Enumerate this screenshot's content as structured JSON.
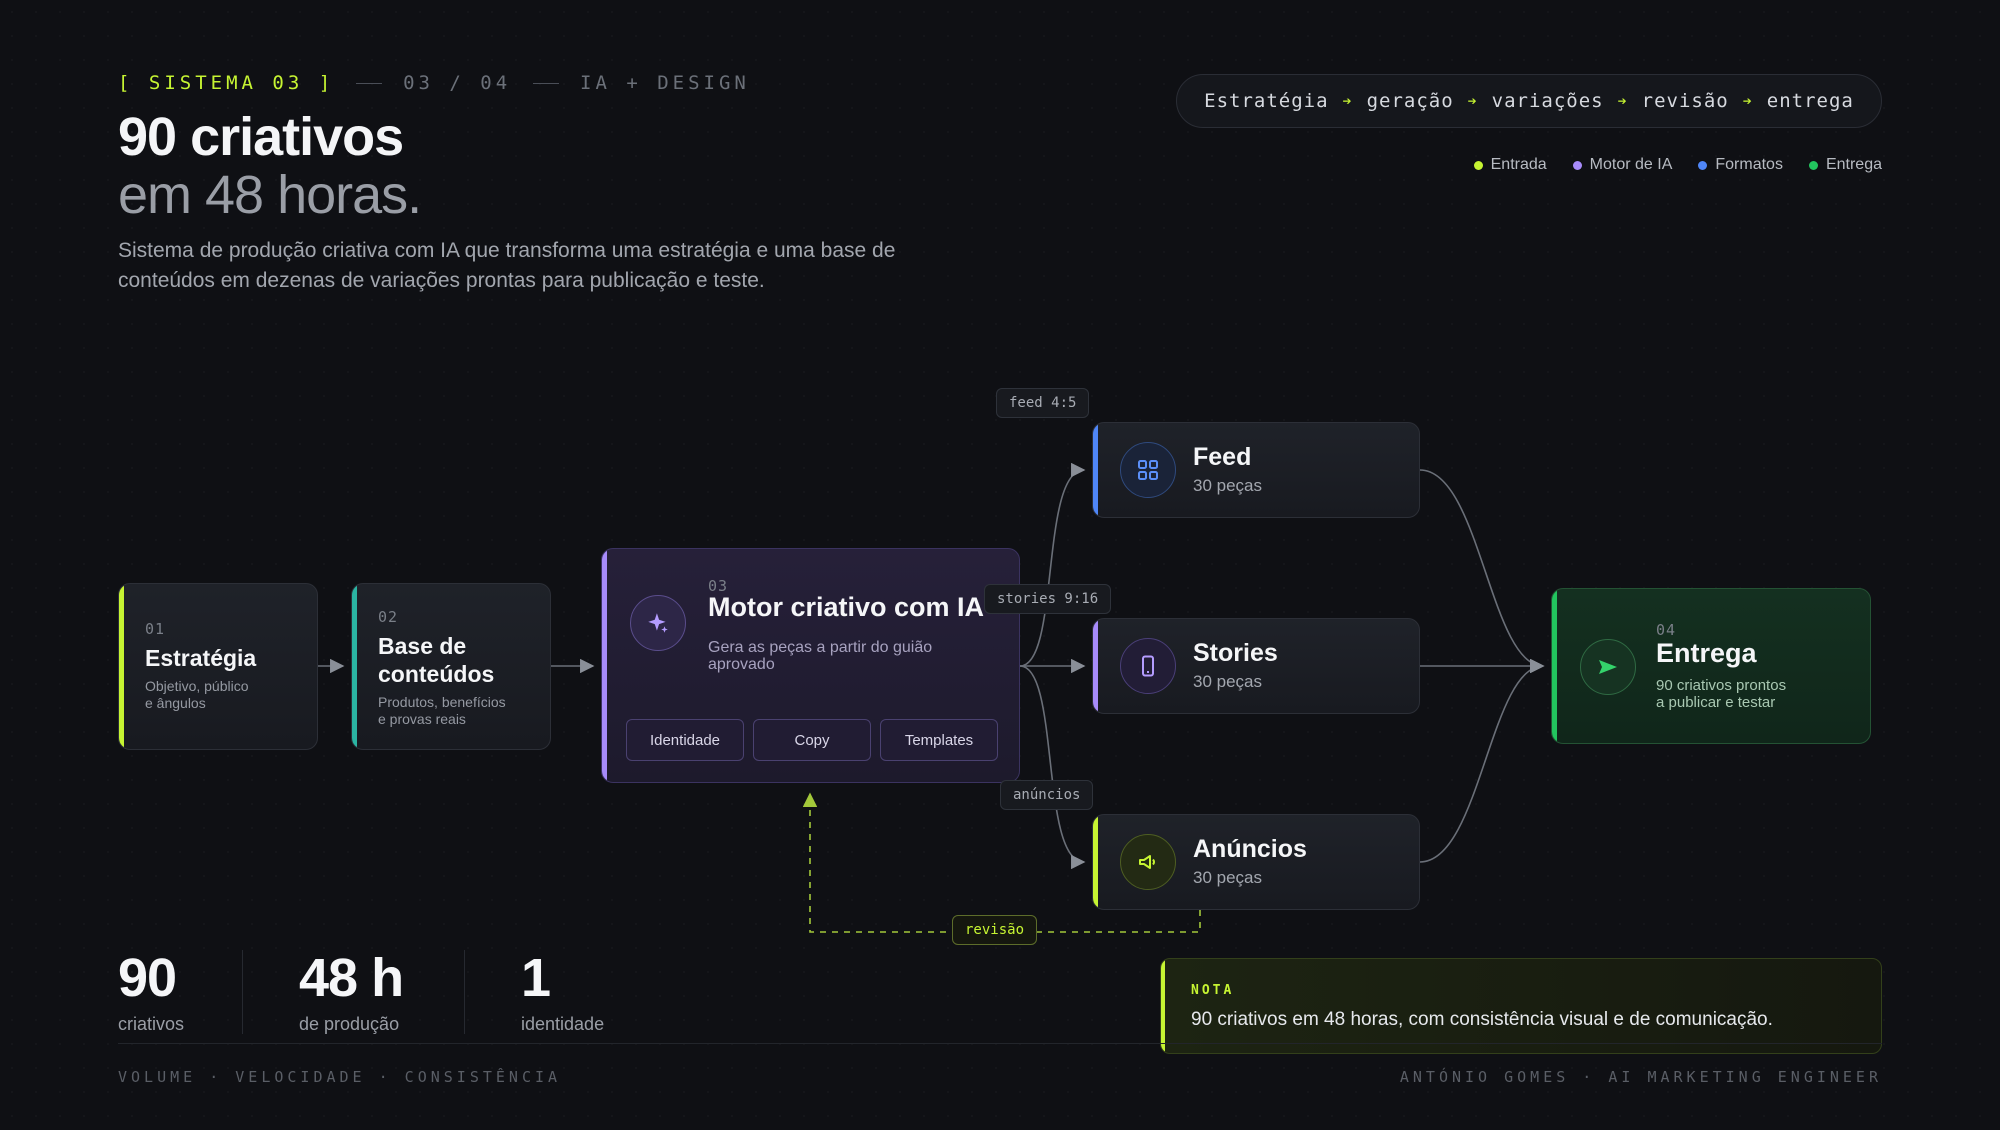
{
  "header": {
    "system_tag": "[ SISTEMA 03 ]",
    "step": "03 / 04",
    "category": "IA + DESIGN",
    "title_line1": "90 criativos",
    "title_line2": "em 48 horas.",
    "description": "Sistema de produção criativa com IA que transforma uma estratégia e uma base de conteúdos em dezenas de variações prontas para publicação e teste."
  },
  "pipeline": [
    "Estratégia",
    "geração",
    "variações",
    "revisão",
    "entrega"
  ],
  "legend": [
    {
      "label": "Entrada",
      "color": "#c6f432"
    },
    {
      "label": "Motor de IA",
      "color": "#a78bfa"
    },
    {
      "label": "Formatos",
      "color": "#4f86f7"
    },
    {
      "label": "Entrega",
      "color": "#22c55e"
    }
  ],
  "nodes": {
    "estrategia": {
      "num": "01",
      "title": "Estratégia",
      "sub1": "Objetivo, público",
      "sub2": "e ângulos",
      "color": "#c6f432"
    },
    "base": {
      "num": "02",
      "title1": "Base de",
      "title2": "conteúdos",
      "sub1": "Produtos, benefícios",
      "sub2": "e provas reais",
      "color": "#2bb5a3"
    },
    "motor": {
      "num": "03",
      "title": "Motor criativo com IA",
      "sub": "Gera as peças a partir do guião aprovado",
      "color": "#a78bfa",
      "icon": "sparkle-icon",
      "chips": [
        "Identidade",
        "Copy",
        "Templates"
      ]
    },
    "feed": {
      "title": "Feed",
      "count": "30 peças",
      "color": "#4f86f7",
      "icon": "grid-icon"
    },
    "stories": {
      "title": "Stories",
      "count": "30 peças",
      "color": "#a78bfa",
      "icon": "phone-icon"
    },
    "anuncios": {
      "title": "Anúncios",
      "count": "30 peças",
      "color": "#c6f432",
      "icon": "megaphone-icon"
    },
    "entrega": {
      "num": "04",
      "title": "Entrega",
      "sub1": "90 criativos prontos",
      "sub2": "a publicar e testar",
      "color": "#22c55e",
      "icon": "send-icon"
    }
  },
  "edge_labels": {
    "feed": "feed 4:5",
    "stories": "stories 9:16",
    "anuncios": "anúncios",
    "revisao": "revisão"
  },
  "stats": [
    {
      "value": "90",
      "label": "criativos"
    },
    {
      "value": "48 h",
      "label": "de produção"
    },
    {
      "value": "1",
      "label": "identidade"
    }
  ],
  "nota": {
    "kicker": "NOTA",
    "text": "90 criativos em 48 horas, com consistência visual e de comunicação."
  },
  "footer": {
    "left": "VOLUME · VELOCIDADE · CONSISTÊNCIA",
    "right": "ANTÓNIO GOMES · AI MARKETING ENGINEER"
  }
}
